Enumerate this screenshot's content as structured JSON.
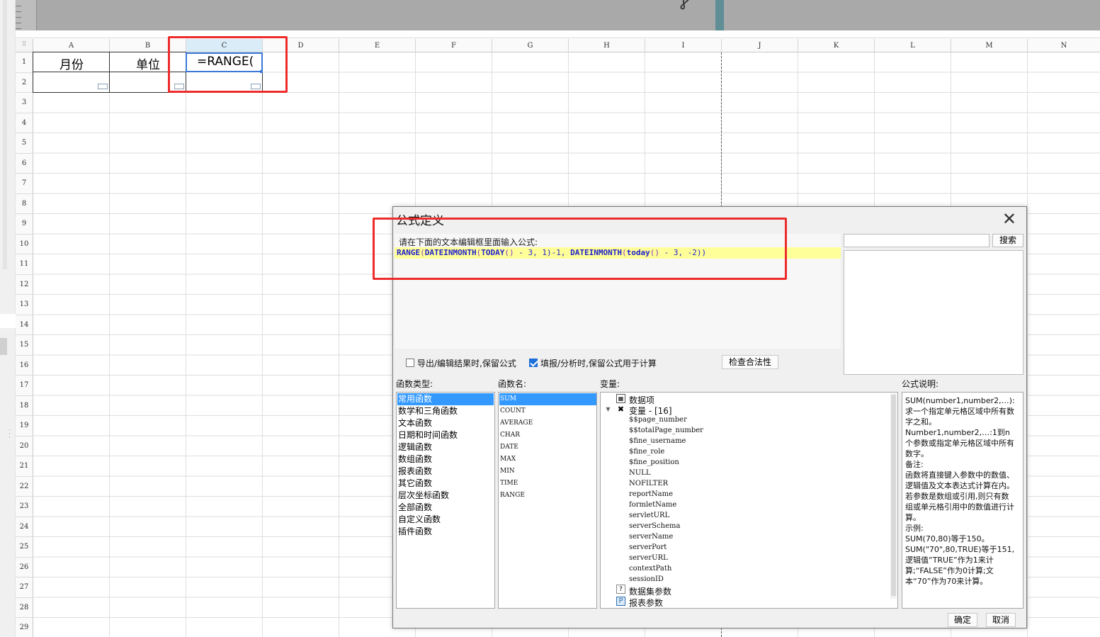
{
  "spreadsheet": {
    "columns": [
      "A",
      "B",
      "C",
      "D",
      "E",
      "F",
      "G",
      "H",
      "I",
      "J",
      "K",
      "L",
      "M",
      "N"
    ],
    "rows": [
      "1",
      "2",
      "3",
      "4",
      "5",
      "6",
      "7",
      "8",
      "9",
      "10",
      "11",
      "12",
      "13",
      "14",
      "15",
      "16",
      "17",
      "18",
      "19",
      "20",
      "21",
      "22",
      "23",
      "24",
      "25",
      "26",
      "27",
      "28",
      "29"
    ],
    "cells": {
      "a1": "月份",
      "b1": "单位",
      "c1": "=RANGE("
    }
  },
  "dialog": {
    "title": "公式定义",
    "editor_hint": "请在下面的文本编辑框里面输入公式:",
    "formula": {
      "t1": "RANGE",
      "t2": "(",
      "t3": "DATEINMONTH",
      "t4": "(",
      "t5": "TODAY",
      "t6": "()",
      "t7": " - 3, 1)-1, ",
      "t8": "DATEINMONTH",
      "t9": "(",
      "t10": "today",
      "t11": "()",
      "t12": " - 3, -2))"
    },
    "search_button": "搜索",
    "search_placeholder": "",
    "export_keep_formula": "导出/编辑结果时,保留公式",
    "fill_keep_formula": "填报/分析时,保留公式用于计算",
    "export_checked": false,
    "fill_checked": true,
    "validate_button": "检查合法性",
    "category_label": "函数类型:",
    "categories": [
      "常用函数",
      "数学和三角函数",
      "文本函数",
      "日期和时间函数",
      "逻辑函数",
      "数组函数",
      "报表函数",
      "其它函数",
      "层次坐标函数",
      "全部函数",
      "自定义函数",
      "插件函数"
    ],
    "function_label": "函数名:",
    "functions": [
      "SUM",
      "COUNT",
      "AVERAGE",
      "CHAR",
      "DATE",
      "MAX",
      "MIN",
      "TIME",
      "RANGE"
    ],
    "variables_label": "变量:",
    "variables": {
      "data_items": "数据项",
      "variable_group": "变量 - [16]",
      "items": [
        "$$page_number",
        "$$totalPage_number",
        "$fine_username",
        "$fine_role",
        "$fine_position",
        "NULL",
        "NOFILTER",
        "reportName",
        "formletName",
        "servletURL",
        "serverSchema",
        "serverName",
        "serverPort",
        "serverURL",
        "contextPath",
        "sessionID"
      ],
      "dataset_params": "数据集参数",
      "report_params": "报表参数"
    },
    "description_label": "公式说明:",
    "description": [
      "SUM(number1,number2,…):求一个指定单元格区域中所有数字之和。",
      "Number1,number2,…:1到n个参数或指定单元格区域中所有数字。",
      "备注:",
      "函数将直接键入参数中的数值、逻辑值及文本表达式计算在内。若参数是数组或引用,则只有数组或单元格引用中的数值进行计算。",
      "示例:",
      "SUM(70,80)等于150。",
      "SUM(\"70\",80,TRUE)等于151,逻辑值“TRUE”作为1来计算;“FALSE”作为0计算;文本“70”作为70来计算。"
    ],
    "ok_button": "确定",
    "cancel_button": "取消"
  },
  "colors": {
    "selection": "#3399ff",
    "highlight_red": "#ee2b2b",
    "formula_line": "#ffff99",
    "active_cell_border": "#3b78d8"
  }
}
